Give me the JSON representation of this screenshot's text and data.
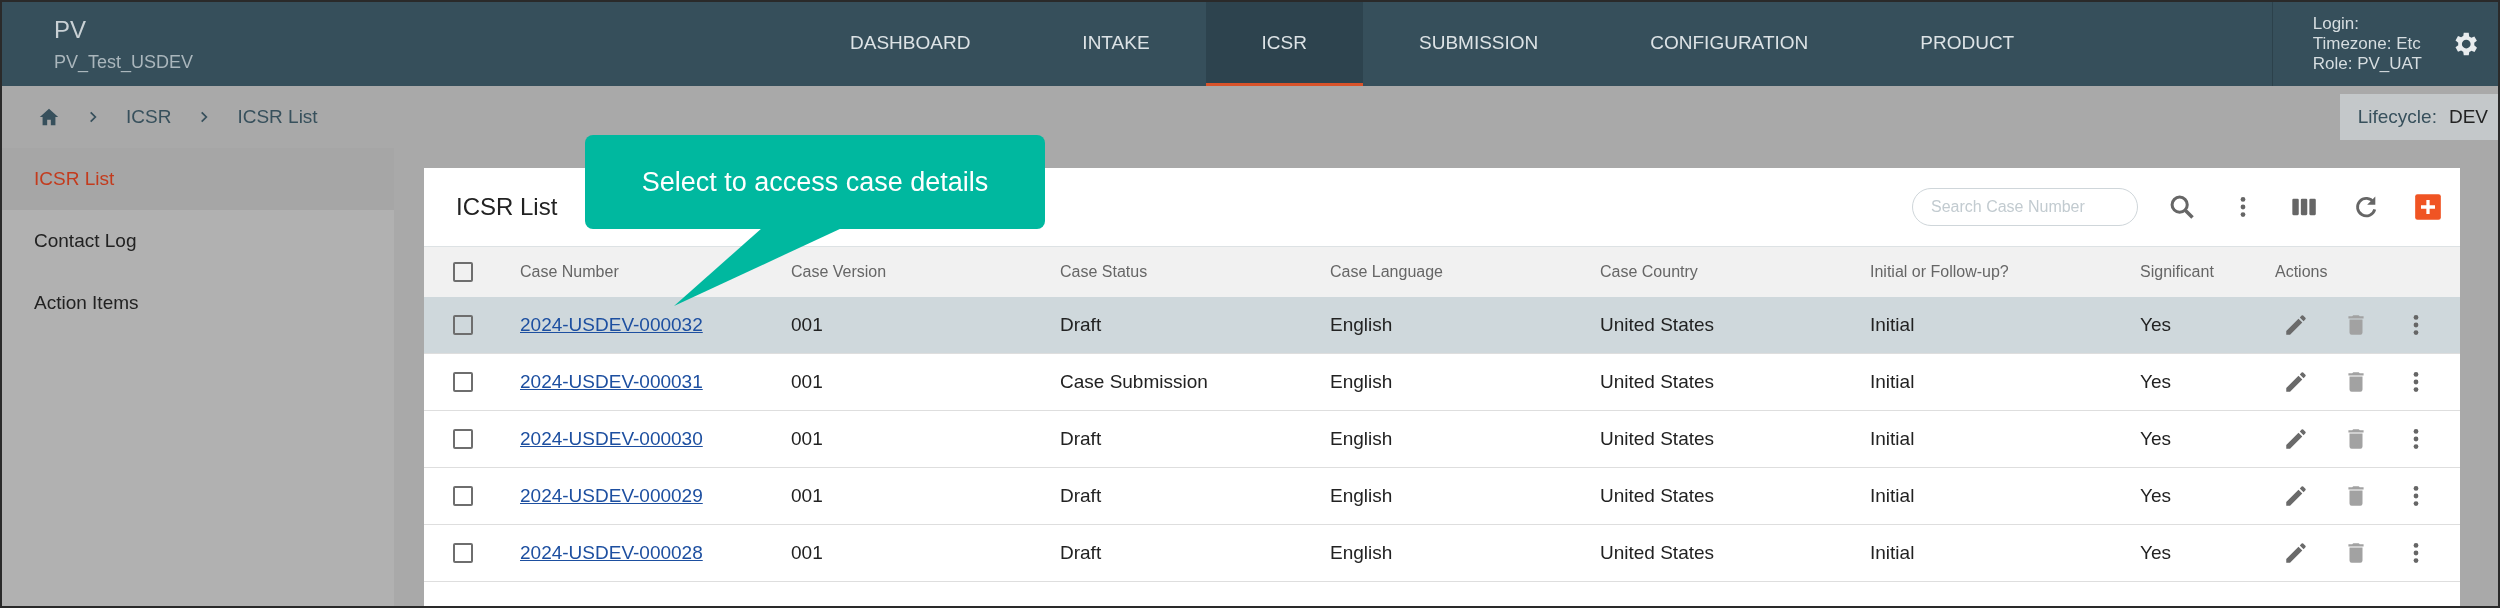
{
  "app": {
    "name": "PV",
    "environment": "PV_Test_USDEV"
  },
  "nav": [
    {
      "label": "DASHBOARD",
      "selected": false
    },
    {
      "label": "INTAKE",
      "selected": false
    },
    {
      "label": "ICSR",
      "selected": true
    },
    {
      "label": "SUBMISSION",
      "selected": false
    },
    {
      "label": "CONFIGURATION",
      "selected": false
    },
    {
      "label": "PRODUCT",
      "selected": false
    }
  ],
  "user": {
    "login_label": "Login:",
    "timezone": "Timezone: Etc",
    "role": "Role: PV_UAT"
  },
  "breadcrumb": [
    "ICSR",
    "ICSR List"
  ],
  "lifecycle": {
    "label": "Lifecycle:",
    "value": "DEV"
  },
  "sidebar": {
    "items": [
      {
        "label": "ICSR List",
        "selected": true
      },
      {
        "label": "Contact Log",
        "selected": false
      },
      {
        "label": "Action Items",
        "selected": false
      }
    ]
  },
  "panel": {
    "title": "ICSR List",
    "search": {
      "placeholder": "Search Case Number"
    }
  },
  "callout": {
    "text": "Select to access case details"
  },
  "table": {
    "header_checked": false,
    "columns": [
      "Case Number",
      "Case Version",
      "Case Status",
      "Case Language",
      "Case Country",
      "Initial or Follow-up?",
      "Significant",
      "Actions"
    ],
    "rows": [
      {
        "selected": true,
        "checked": false,
        "cells": [
          "2024-USDEV-000032",
          "001",
          "Draft",
          "English",
          "United States",
          "Initial",
          "Yes"
        ]
      },
      {
        "selected": false,
        "checked": false,
        "cells": [
          "2024-USDEV-000031",
          "001",
          "Case Submission",
          "English",
          "United States",
          "Initial",
          "Yes"
        ]
      },
      {
        "selected": false,
        "checked": false,
        "cells": [
          "2024-USDEV-000030",
          "001",
          "Draft",
          "English",
          "United States",
          "Initial",
          "Yes"
        ]
      },
      {
        "selected": false,
        "checked": false,
        "cells": [
          "2024-USDEV-000029",
          "001",
          "Draft",
          "English",
          "United States",
          "Initial",
          "Yes"
        ]
      },
      {
        "selected": false,
        "checked": false,
        "cells": [
          "2024-USDEV-000028",
          "001",
          "Draft",
          "English",
          "United States",
          "Initial",
          "Yes"
        ]
      }
    ]
  }
}
